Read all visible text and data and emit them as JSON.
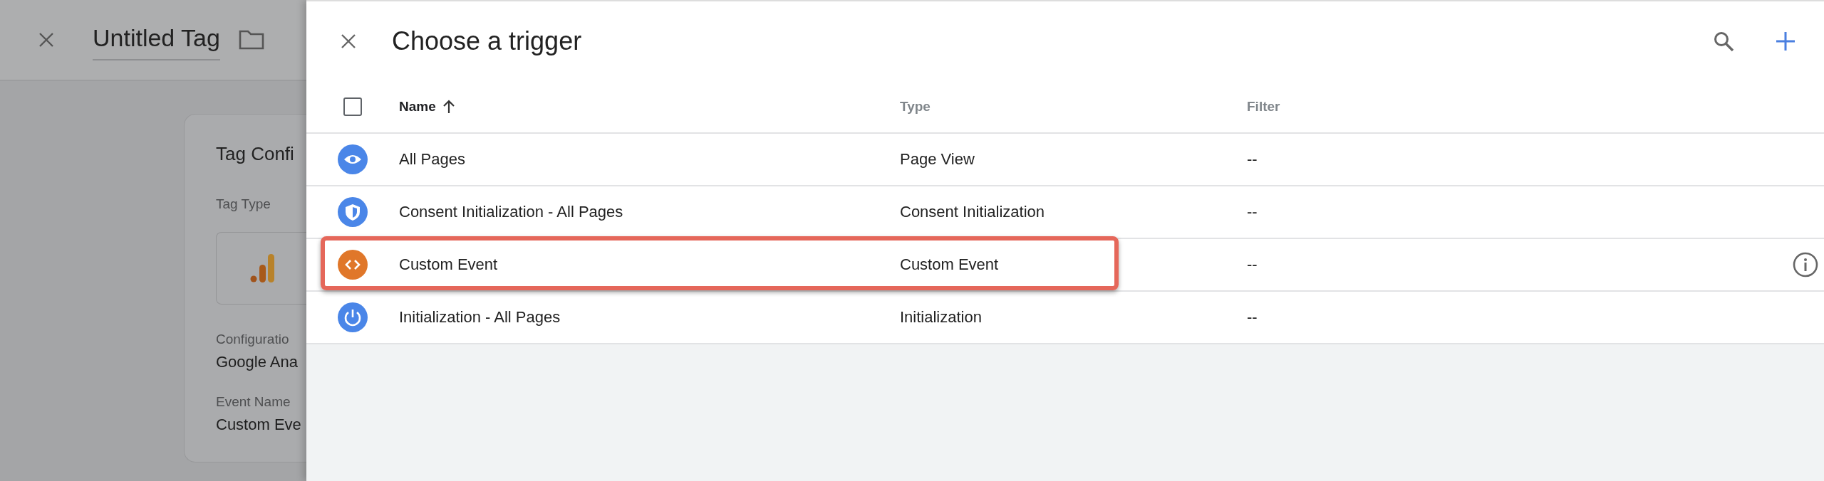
{
  "editor": {
    "title": "Untitled Tag",
    "card": {
      "heading": "Tag Confi",
      "tag_type_label": "Tag Type",
      "fields": [
        {
          "label": "Configuratio",
          "value": "Google Ana"
        },
        {
          "label": "Event Name",
          "value": "Custom Eve"
        }
      ]
    }
  },
  "panel": {
    "title": "Choose a trigger",
    "table": {
      "columns": [
        {
          "label": "Name",
          "sorted": true
        },
        {
          "label": "Type",
          "sorted": false
        },
        {
          "label": "Filter",
          "sorted": false
        }
      ],
      "select_all": {
        "checked": false
      },
      "rows": [
        {
          "name": "All Pages",
          "type": "Page View",
          "filter": "--",
          "kind": "eye",
          "color": "#4a86e8",
          "highlighted": false,
          "info": false
        },
        {
          "name": "Consent Initialization - All Pages",
          "type": "Consent Initialization",
          "filter": "--",
          "kind": "shield",
          "color": "#4a86e8",
          "highlighted": false,
          "info": false
        },
        {
          "name": "Custom Event",
          "type": "Custom Event",
          "filter": "--",
          "kind": "code",
          "color": "#e0772a",
          "highlighted": true,
          "info": true
        },
        {
          "name": "Initialization - All Pages",
          "type": "Initialization",
          "filter": "--",
          "kind": "power",
          "color": "#4a86e8",
          "highlighted": false,
          "info": false
        }
      ]
    }
  }
}
